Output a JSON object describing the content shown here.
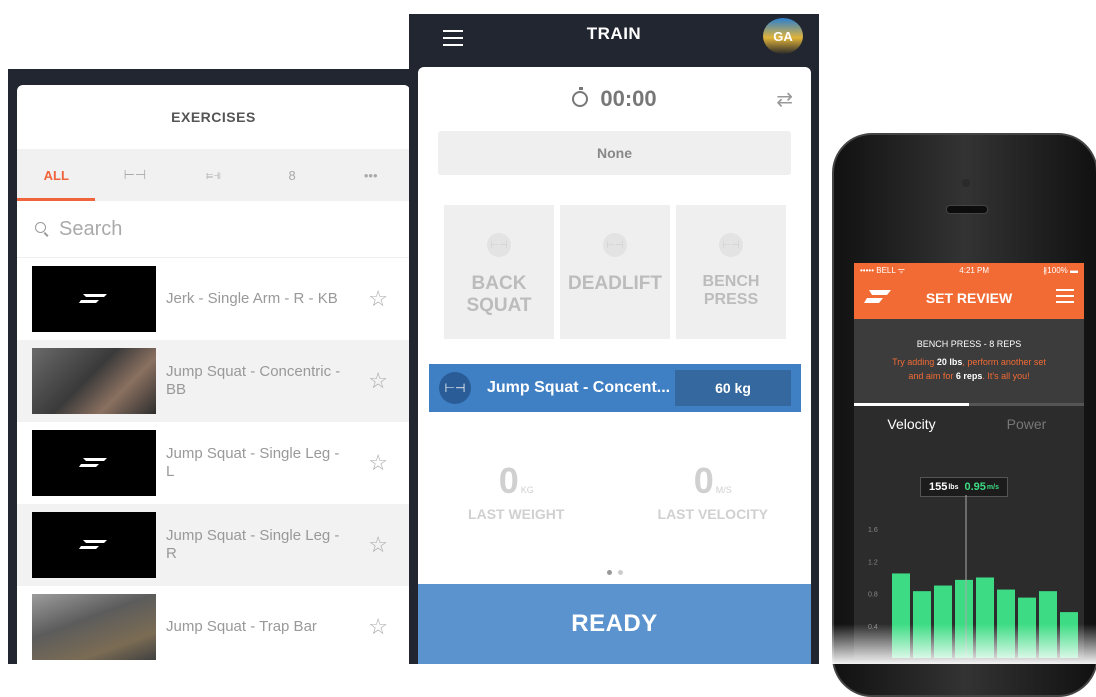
{
  "exercises": {
    "title": "EXERCISES",
    "filters": [
      {
        "label": "ALL"
      },
      {
        "label": "⊢⊣"
      },
      {
        "label": "⫢⫣"
      },
      {
        "label": "8"
      },
      {
        "label": "•••"
      }
    ],
    "search_placeholder": "Search",
    "items": [
      {
        "name": "Jerk - Single Arm - R - KB"
      },
      {
        "name": "Jump Squat - Concentric - BB"
      },
      {
        "name": "Jump Squat - Single Leg - L"
      },
      {
        "name": "Jump Squat - Single Leg - R"
      },
      {
        "name": "Jump Squat - Trap Bar"
      }
    ]
  },
  "train": {
    "title": "TRAIN",
    "avatar_initials": "GA",
    "timer": "00:00",
    "none_label": "None",
    "lifts": [
      {
        "name": "BACK SQUAT"
      },
      {
        "name": "DEADLIFT"
      },
      {
        "name": "BENCH PRESS"
      }
    ],
    "active_exercise": "Jump Squat - Concent...",
    "active_weight": "60 kg",
    "last_weight_value": "0",
    "last_weight_unit": "KG",
    "last_weight_label": "LAST WEIGHT",
    "last_velocity_value": "0",
    "last_velocity_unit": "M/S",
    "last_velocity_label": "LAST VELOCITY",
    "ready_label": "READY"
  },
  "phone": {
    "status_carrier": "••••• BELL ᯤ",
    "status_time": "4:21 PM",
    "status_battery": "∦100% ▬",
    "title": "SET REVIEW",
    "set_title": "BENCH PRESS - 8 REPS",
    "tip_1": "Try adding ",
    "tip_2": "20 lbs",
    "tip_3": ", perform another set",
    "tip_4": "and aim for ",
    "tip_5": "6 reps",
    "tip_6": ". It's all you!",
    "tab_velocity": "Velocity",
    "tab_power": "Power",
    "reading_weight": "155",
    "reading_weight_unit": "lbs",
    "reading_velocity": "0.95",
    "reading_velocity_unit": "m/s",
    "progress": 0.5,
    "colors": {
      "accent": "#f26b35",
      "bar": "#3ddc84",
      "blue": "#3f7fc4"
    },
    "chart_data": {
      "type": "bar",
      "yticks": [
        "1.6",
        "1.2",
        "0.8",
        "0.4"
      ],
      "values": [
        1.05,
        0.83,
        0.9,
        0.97,
        1.0,
        0.85,
        0.75,
        0.83,
        0.57
      ],
      "ylim": [
        0,
        1.9
      ]
    }
  }
}
